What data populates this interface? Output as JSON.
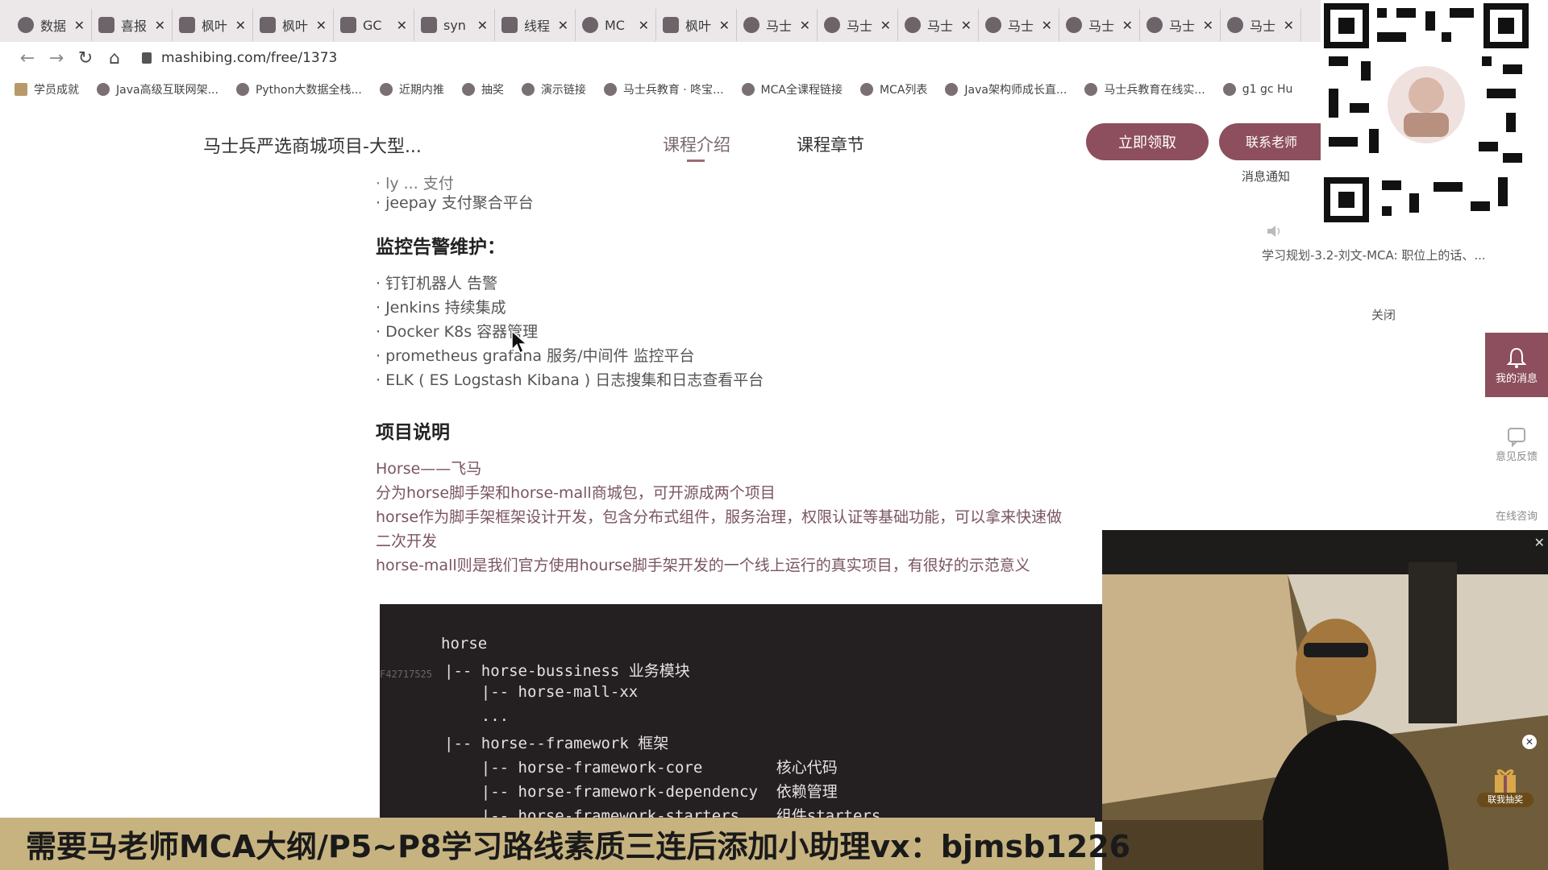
{
  "tabs": [
    {
      "title": "数据",
      "favicon": "round"
    },
    {
      "title": "喜报",
      "favicon": "square"
    },
    {
      "title": "枫叶",
      "favicon": "square"
    },
    {
      "title": "枫叶",
      "favicon": "square"
    },
    {
      "title": "GC",
      "favicon": "square"
    },
    {
      "title": "syn",
      "favicon": "square"
    },
    {
      "title": "线程",
      "favicon": "square"
    },
    {
      "title": "MC",
      "favicon": "round"
    },
    {
      "title": "枫叶",
      "favicon": "square"
    },
    {
      "title": "马士",
      "favicon": "round"
    },
    {
      "title": "马士",
      "favicon": "round"
    },
    {
      "title": "马士",
      "favicon": "round"
    },
    {
      "title": "马士",
      "favicon": "round"
    },
    {
      "title": "马士",
      "favicon": "round"
    },
    {
      "title": "马士",
      "favicon": "round"
    },
    {
      "title": "马士",
      "favicon": "round"
    }
  ],
  "address": {
    "url": "mashibing.com/free/1373"
  },
  "bookmarks": [
    "学员成就",
    "Java高级互联网架...",
    "Python大数据全栈...",
    "近期内推",
    "抽奖",
    "演示链接",
    "马士兵教育 · 咚宝...",
    "MCA全课程链接",
    "MCA列表",
    "Java架构师成长直...",
    "马士兵教育在线实...",
    "g1 gc Hu"
  ],
  "header": {
    "course_title": "马士兵严选商城项目-大型...",
    "nav_intro": "课程介绍",
    "nav_chapters": "课程章节",
    "claim_button": "立即领取",
    "contact_button": "联系老师"
  },
  "article": {
    "partial_top": "· ly ... 支付",
    "jeepay": "· jeepay 支付聚合平台",
    "monitor_heading": "监控告警维护：",
    "monitor_items": [
      "· 钉钉机器人 告警",
      "· Jenkins 持续集成",
      "· Docker K8s 容器管理",
      "· prometheus grafana 服务/中间件 监控平台",
      "· ELK ( ES Logstash Kibana ) 日志搜集和日志查看平台"
    ],
    "project_heading": "项目说明",
    "project_lines": [
      "Horse——飞马",
      "分为horse脚手架和horse-mall商城包，可开源成两个项目",
      "horse作为脚手架框架设计开发，包含分布式组件，服务治理，权限认证等基础功能，可以拿来快速做",
      "二次开发",
      "horse-mall则是我们官方使用hourse脚手架开发的一个线上运行的真实项目，有很好的示范意义"
    ]
  },
  "code": {
    "watermark": "F42717525",
    "lines": [
      "horse",
      "|-- horse-bussiness 业务模块",
      "    |-- horse-mall-xx",
      "    ...",
      "|-- horse--framework 框架",
      "    |-- horse-framework-core        核心代码",
      "    |-- horse-framework-dependency  依赖管理",
      "    |-- horse-framework-starters    组件starters"
    ]
  },
  "notifications": {
    "title": "消息通知",
    "preview": "学习规划-3.2-刘文-MCA: 职位上的话、...",
    "close": "关闭"
  },
  "rail": {
    "messages": "我的消息",
    "feedback": "意见反馈",
    "consult": "在线咨询"
  },
  "video": {
    "badge": "联我抽奖"
  },
  "banner": {
    "text": "需要马老师MCA大纲/P5~P8学习路线素质三连后添加小助理vx：bjmsb1226"
  }
}
